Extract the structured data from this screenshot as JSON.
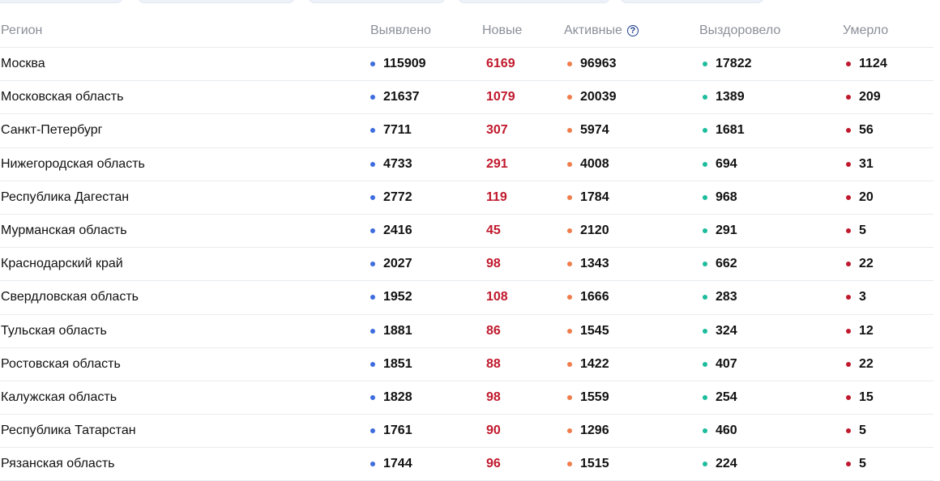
{
  "colors": {
    "found": "#3d6cde",
    "new": "#c0182c",
    "active": "#f07c4a",
    "recovered": "#1dbc9c",
    "deaths": "#c0182c"
  },
  "header": {
    "region": "Регион",
    "found": "Выявлено",
    "new": "Новые",
    "active": "Активные",
    "active_help": "?",
    "recovered": "Выздоровело",
    "deaths": "Умерло"
  },
  "rows": [
    {
      "region": "Москва",
      "found": "115909",
      "new": "6169",
      "active": "96963",
      "recovered": "17822",
      "deaths": "1124"
    },
    {
      "region": "Московская область",
      "found": "21637",
      "new": "1079",
      "active": "20039",
      "recovered": "1389",
      "deaths": "209"
    },
    {
      "region": "Санкт-Петербург",
      "found": "7711",
      "new": "307",
      "active": "5974",
      "recovered": "1681",
      "deaths": "56"
    },
    {
      "region": "Нижегородская область",
      "found": "4733",
      "new": "291",
      "active": "4008",
      "recovered": "694",
      "deaths": "31"
    },
    {
      "region": "Республика Дагестан",
      "found": "2772",
      "new": "119",
      "active": "1784",
      "recovered": "968",
      "deaths": "20"
    },
    {
      "region": "Мурманская область",
      "found": "2416",
      "new": "45",
      "active": "2120",
      "recovered": "291",
      "deaths": "5"
    },
    {
      "region": "Краснодарский край",
      "found": "2027",
      "new": "98",
      "active": "1343",
      "recovered": "662",
      "deaths": "22"
    },
    {
      "region": "Свердловская область",
      "found": "1952",
      "new": "108",
      "active": "1666",
      "recovered": "283",
      "deaths": "3"
    },
    {
      "region": "Тульская область",
      "found": "1881",
      "new": "86",
      "active": "1545",
      "recovered": "324",
      "deaths": "12"
    },
    {
      "region": "Ростовская область",
      "found": "1851",
      "new": "88",
      "active": "1422",
      "recovered": "407",
      "deaths": "22"
    },
    {
      "region": "Калужская область",
      "found": "1828",
      "new": "98",
      "active": "1559",
      "recovered": "254",
      "deaths": "15"
    },
    {
      "region": "Республика Татарстан",
      "found": "1761",
      "new": "90",
      "active": "1296",
      "recovered": "460",
      "deaths": "5"
    },
    {
      "region": "Рязанская область",
      "found": "1744",
      "new": "96",
      "active": "1515",
      "recovered": "224",
      "deaths": "5"
    }
  ]
}
